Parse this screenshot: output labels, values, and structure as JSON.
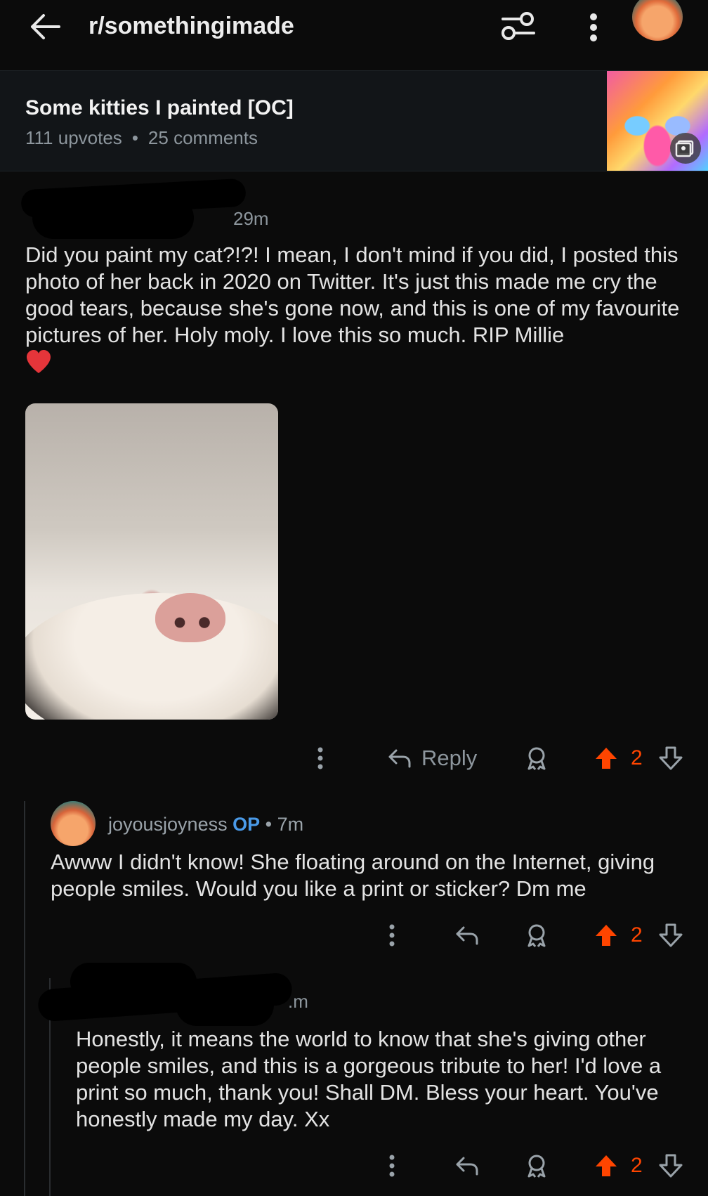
{
  "topbar": {
    "subreddit": "r/somethingimade"
  },
  "post": {
    "title": "Some kitties I painted [OC]",
    "upvotes": "111 upvotes",
    "separator": "•",
    "comments": "25 comments"
  },
  "comments": [
    {
      "time": "29m",
      "body": "Did you paint my cat?!?! I mean, I don't mind if you did, I posted this photo of her back in 2020 on Twitter. It's just this made me cry the good tears, because she's gone now, and this is one of my favourite pictures of her. Holy moly. I love this so much. RIP Millie",
      "reply_label": "Reply",
      "votes": "2"
    },
    {
      "username": "joyousjoyness",
      "badge": "OP",
      "time": "• 7m",
      "body": "Awww I didn't know! She floating around on the Internet, giving people smiles. Would you like a print or sticker? Dm me",
      "votes": "2"
    },
    {
      "time": ".m",
      "body": "Honestly, it means the world to know that she's giving other people smiles, and this is a gorgeous tribute to her! I'd love a print so much, thank you! Shall DM. Bless your heart. You've honestly made my day. Xx",
      "votes": "2"
    }
  ],
  "colors": {
    "background": "#0b0b0b",
    "upvote": "#ff4500",
    "op_badge": "#4a9ae8",
    "muted": "#8d969d"
  }
}
